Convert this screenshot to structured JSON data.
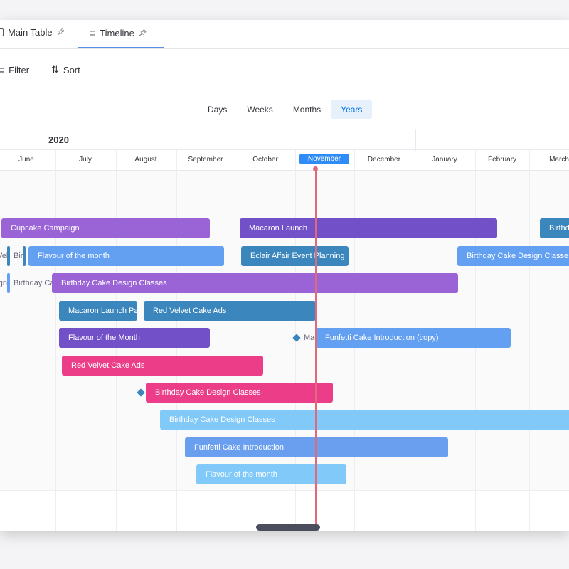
{
  "tabs": [
    {
      "label": "Main Table",
      "icon": "table-icon"
    },
    {
      "label": "Timeline",
      "icon": "timeline-icon",
      "active": true
    }
  ],
  "toolbar": {
    "filter": "Filter",
    "sort": "Sort"
  },
  "views": [
    "Days",
    "Weeks",
    "Months",
    "Years"
  ],
  "active_view": "Years",
  "year": "2020",
  "months": [
    "June",
    "July",
    "August",
    "September",
    "October",
    "November",
    "December",
    "January",
    "February",
    "March"
  ],
  "current_month": "November",
  "bars": {
    "r1a": "Cupcake Campaign",
    "r1b": "Macaron Launch",
    "r1c": "Birthday Cake Design Classes",
    "r2t1": "Velvet",
    "r2t2": "Birthday",
    "r2a": "Flavour of the month",
    "r2b": "Eclair Affair Event Planning",
    "r2c": "Birthday Cake Design Classes",
    "r3t1": "Design",
    "r3t2": "Birthday Cake",
    "r3a": "Birthday Cake Design Classes",
    "r4a": "Macaron Launch Party",
    "r4b": "Red Velvet Cake Ads",
    "r5a": "Flavour of the Month",
    "r5t": "Macaron",
    "r5b": "Funfetti Cake Introduction (copy)",
    "r6a": "Red Velvet Cake Ads",
    "r7a": "Birthday Cake Design Classes",
    "r8a": "Birthday Cake Design Classes",
    "r9a": "Funfetti Cake Introduction",
    "r10a": "Flavour of the month"
  },
  "colors": {
    "purple": "#9a63d6",
    "dark_purple": "#7150c8",
    "teal_blue": "#3a86bd",
    "blue": "#64a0f2",
    "pink": "#ec3d88",
    "light_blue": "#80c9f9",
    "today_line": "#e06a79",
    "accent": "#0073ea"
  }
}
